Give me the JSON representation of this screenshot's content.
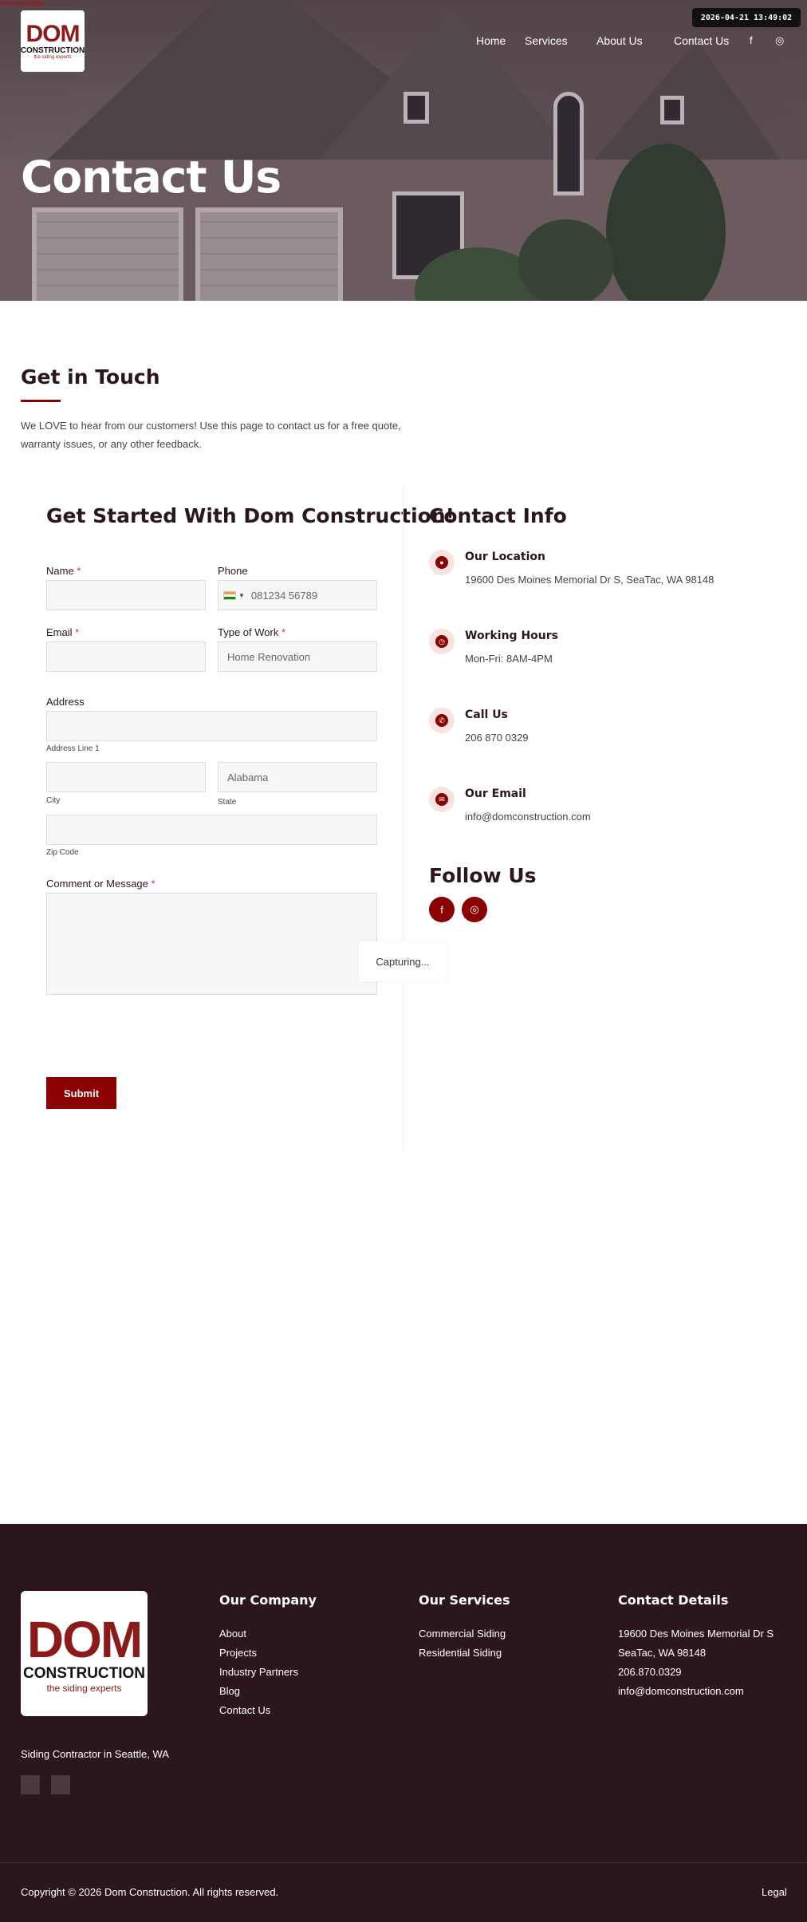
{
  "debug_label": "ScreenshotEdit",
  "timestamp": "2026-04-21 13:49:02",
  "logo": {
    "big": "DOM",
    "word": "CONSTRUCTION",
    "tagline": "the siding experts"
  },
  "nav": [
    "Home",
    "Services",
    "About Us",
    "Contact Us"
  ],
  "hero": {
    "title": "Contact Us"
  },
  "intro": {
    "title": "Get in Touch",
    "text": "We LOVE to hear from our customers! Use this page to contact us for a free quote, warranty issues, or any other feedback."
  },
  "form": {
    "title": "Get Started With Dom Construction!",
    "name_label": "Name",
    "phone_label": "Phone",
    "phone_placeholder": "081234 56789",
    "email_label": "Email",
    "work_label": "Type of Work",
    "work_value": "Home Renovation",
    "address_label": "Address",
    "address_line1": "Address Line 1",
    "city": "City",
    "state": "State",
    "state_value": "Alabama",
    "zip": "Zip Code",
    "comment_label": "Comment or Message",
    "required": "*",
    "submit": "Submit"
  },
  "capture_text": "Capturing...",
  "contact": {
    "title": "Contact Info",
    "items": [
      {
        "icon": "location-pin-icon",
        "title": "Our Location",
        "value": "19600 Des Moines Memorial Dr S, SeaTac, WA 98148"
      },
      {
        "icon": "clock-icon",
        "title": "Working Hours",
        "value": "Mon-Fri: 8AM-4PM"
      },
      {
        "icon": "phone-icon",
        "title": "Call Us",
        "value": "206 870 0329"
      },
      {
        "icon": "envelope-icon",
        "title": "Our Email",
        "value": "info@domconstruction.com"
      }
    ],
    "follow": "Follow Us"
  },
  "footer": {
    "tagline": "Siding Contractor in Seattle, WA",
    "company_title": "Our Company",
    "company_links": [
      "About",
      "Projects",
      "Industry Partners",
      "Blog",
      "Contact Us"
    ],
    "services_title": "Our Services",
    "services_links": [
      "Commercial Siding",
      "Residential Siding"
    ],
    "details_title": "Contact Details",
    "details": [
      "19600 Des Moines Memorial Dr S",
      "SeaTac, WA 98148",
      "206.870.0329",
      "info@domconstruction.com"
    ],
    "copyright": "Copyright © 2026 Dom Construction. All rights reserved.",
    "legal": "Legal"
  },
  "colors": {
    "brand": "#8b0000",
    "footer_bg": "#2b161b",
    "icon_bg": "#f9e3e1"
  }
}
